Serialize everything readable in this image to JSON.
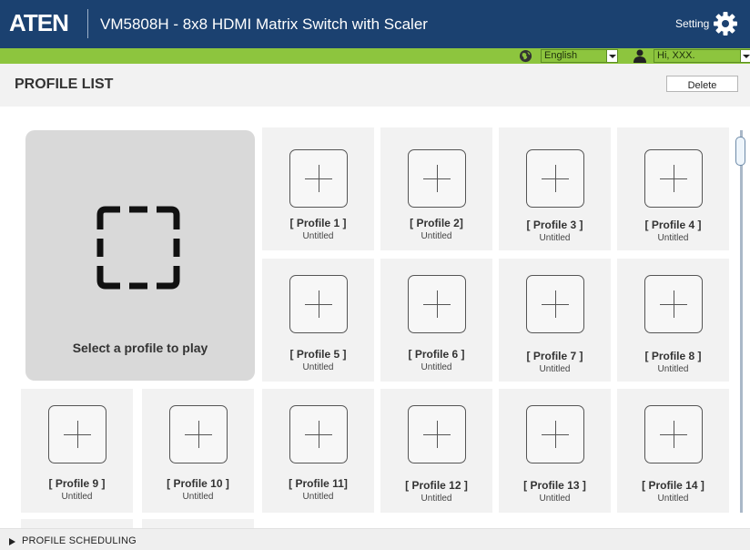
{
  "header": {
    "logo": "ATEN",
    "title": "VM5808H - 8x8 HDMI Matrix Switch with Scaler",
    "setting_label": "Setting"
  },
  "toolbar": {
    "language": "English",
    "user": "Hi, XXX."
  },
  "profile_list": {
    "title": "PROFILE LIST",
    "delete_label": "Delete",
    "play_prompt": "Select a profile to play",
    "profiles": [
      {
        "name": "[ Profile 1 ]",
        "status": "Untitled"
      },
      {
        "name": "[ Profile 2]",
        "status": "Untitled"
      },
      {
        "name": "[ Profile 3 ]",
        "status": "Untitled"
      },
      {
        "name": "[ Profile 4 ]",
        "status": "Untitled"
      },
      {
        "name": "[ Profile 5 ]",
        "status": "Untitled"
      },
      {
        "name": "[ Profile 6 ]",
        "status": "Untitled"
      },
      {
        "name": "[ Profile 7 ]",
        "status": "Untitled"
      },
      {
        "name": "[ Profile 8 ]",
        "status": "Untitled"
      },
      {
        "name": "[ Profile 9 ]",
        "status": "Untitled"
      },
      {
        "name": "[ Profile 10 ]",
        "status": "Untitled"
      },
      {
        "name": "[ Profile 11]",
        "status": "Untitled"
      },
      {
        "name": "[ Profile 12 ]",
        "status": "Untitled"
      },
      {
        "name": "[ Profile 13 ]",
        "status": "Untitled"
      },
      {
        "name": "[ Profile 14 ]",
        "status": "Untitled"
      }
    ]
  },
  "footer": {
    "scheduling_label": "PROFILE SCHEDULING"
  },
  "colors": {
    "header_bg": "#1b4170",
    "accent_green": "#8dc53e",
    "tile_bg": "#f2f2f2",
    "play_bg": "#d9d9d9"
  }
}
